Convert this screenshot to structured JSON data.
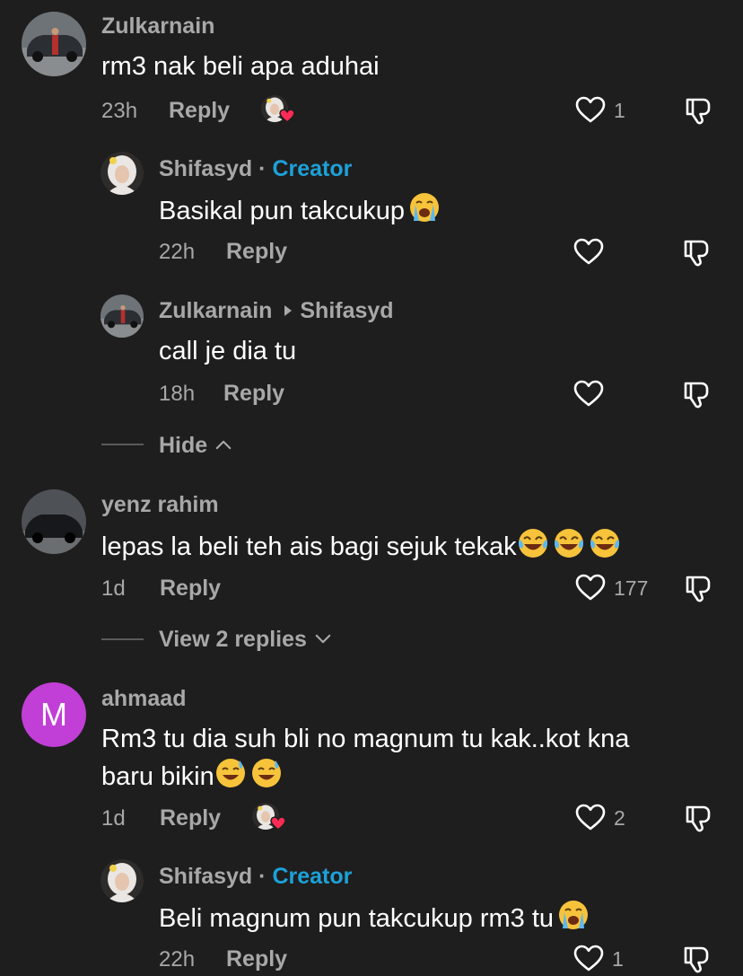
{
  "comments": [
    {
      "author": "Zulkarnain",
      "text": "rm3 nak beli apa aduhai",
      "time": "23h",
      "reply_label": "Reply",
      "likes": "1",
      "replies": [
        {
          "author": "Shifasyd",
          "separator": "·",
          "badge": "Creator",
          "text": "Basikal pun takcukup",
          "time": "22h",
          "reply_label": "Reply"
        },
        {
          "author": "Zulkarnain",
          "reply_to": "Shifasyd",
          "text": "call je dia tu",
          "time": "18h",
          "reply_label": "Reply"
        }
      ],
      "hide_label": "Hide"
    },
    {
      "author": "yenz rahim",
      "text": "lepas la beli teh ais bagi sejuk tekak",
      "time": "1d",
      "reply_label": "Reply",
      "likes": "177",
      "view_replies_label": "View 2 replies"
    },
    {
      "author": "ahmaad",
      "avatar_letter": "M",
      "text_line1": "Rm3 tu dia suh bli no magnum tu kak..kot kna",
      "text_line2": "baru bikin",
      "time": "1d",
      "reply_label": "Reply",
      "likes": "2",
      "replies": [
        {
          "author": "Shifasyd",
          "separator": "·",
          "badge": "Creator",
          "text": "Beli magnum pun takcukup rm3 tu",
          "time": "22h",
          "reply_label": "Reply",
          "likes": "1"
        }
      ]
    }
  ],
  "colors": {
    "background": "#1e1e1e",
    "creator_badge": "#1da1d8",
    "muted": "#a8a8a8",
    "avatar_m": "#c13fd6"
  }
}
